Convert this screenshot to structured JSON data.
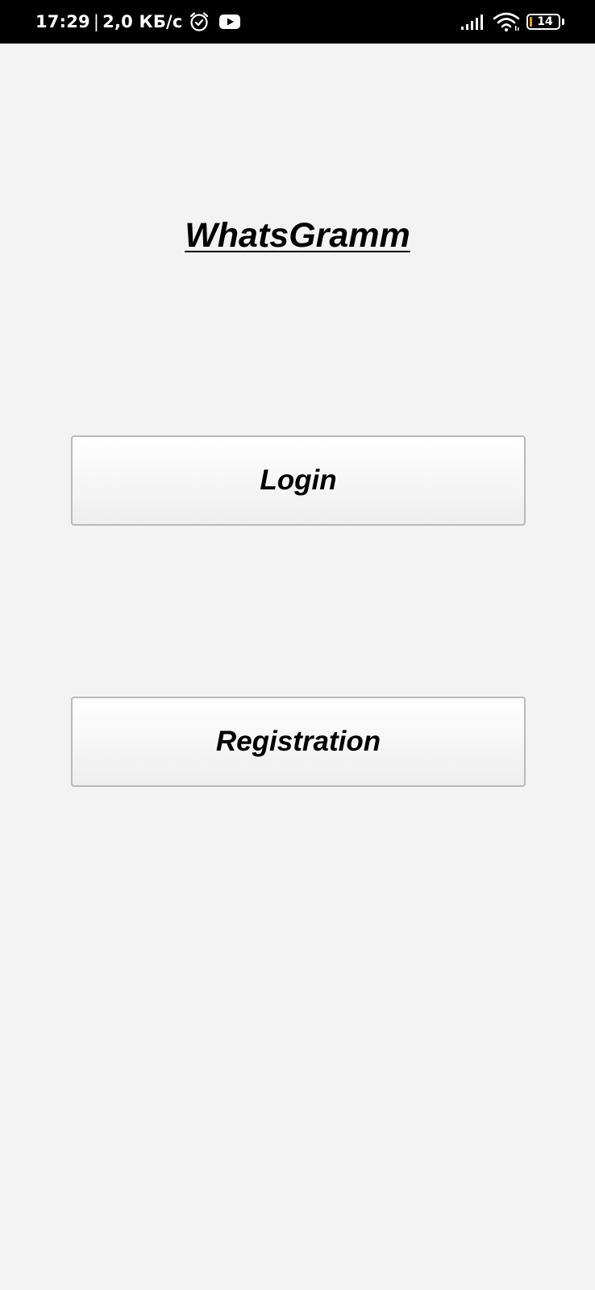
{
  "status_bar": {
    "time": "17:29",
    "separator": "|",
    "speed": "2,0 КБ/с",
    "battery_level": "14",
    "icons": [
      "alarm-icon",
      "youtube-icon",
      "signal-icon",
      "wifi-icon",
      "battery-icon"
    ]
  },
  "app": {
    "title": "WhatsGramm"
  },
  "buttons": {
    "login_label": "Login",
    "registration_label": "Registration"
  },
  "colors": {
    "background": "#f3f3f3",
    "status_bar": "#000000",
    "battery_fill": "#f0a020"
  }
}
